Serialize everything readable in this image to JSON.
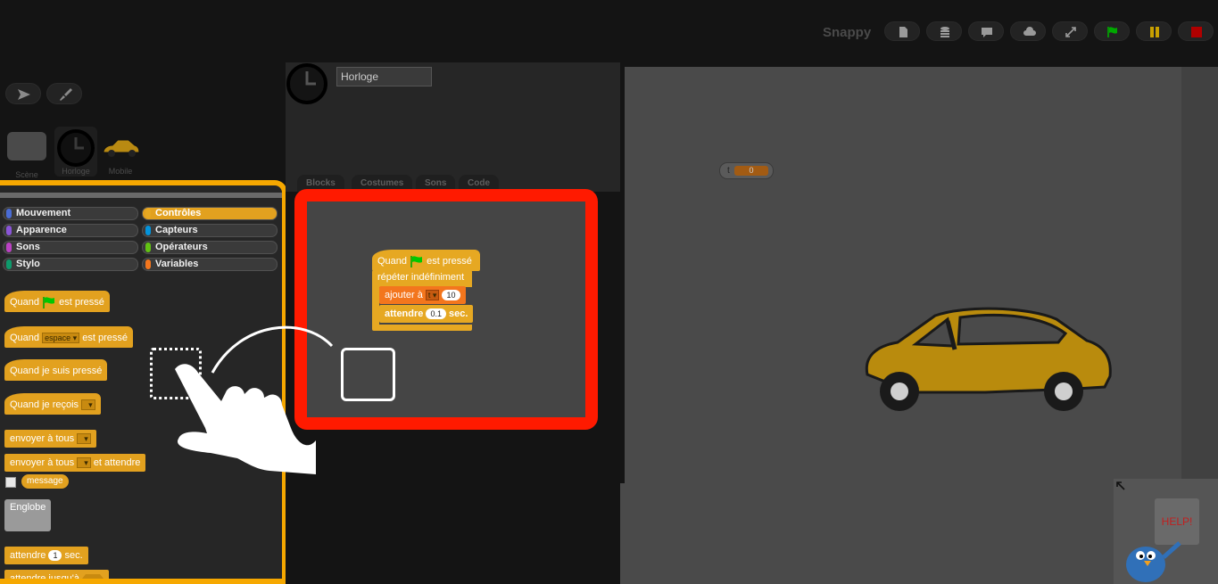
{
  "app": {
    "title": "Snappy"
  },
  "toolbar": {
    "icons": [
      "file-icon",
      "database-icon",
      "comment-icon",
      "cloud-icon",
      "fullscreen-icon",
      "green-flag-icon",
      "pause-icon",
      "stop-icon"
    ]
  },
  "corral": {
    "items": [
      {
        "label": "Scène"
      },
      {
        "label": "Horloge"
      },
      {
        "label": "Mobile"
      }
    ]
  },
  "categories": {
    "left": [
      {
        "label": "Mouvement",
        "color": "#4a6cd4"
      },
      {
        "label": "Apparence",
        "color": "#8a55d7"
      },
      {
        "label": "Sons",
        "color": "#bb42c3"
      },
      {
        "label": "Stylo",
        "color": "#0e9a6c"
      }
    ],
    "right": [
      {
        "label": "Contrôles",
        "color": "#e6a822",
        "selected": true
      },
      {
        "label": "Capteurs",
        "color": "#0494dc"
      },
      {
        "label": "Opérateurs",
        "color": "#62c213"
      },
      {
        "label": "Variables",
        "color": "#f3761d"
      }
    ]
  },
  "palette_blocks": {
    "flag_hat": {
      "when": "Quand",
      "pressed": "est pressé"
    },
    "key_hat": {
      "when": "Quand",
      "key": "espace",
      "pressed": "est pressé"
    },
    "clicked_hat": {
      "text": "Quand je suis pressé"
    },
    "receive_hat": {
      "text": "Quand je reçois"
    },
    "broadcast": {
      "text": "envoyer à tous"
    },
    "broadcast_wait": {
      "text": "envoyer à tous",
      "suffix": "et attendre"
    },
    "message": {
      "text": "message"
    },
    "wrap": {
      "text": "Englobe"
    },
    "wait": {
      "text": "attendre",
      "value": "1",
      "unit": "sec."
    },
    "wait_until": {
      "text": "attendre jusqu'à"
    }
  },
  "editor": {
    "sprite_name": "Horloge",
    "tabs": [
      "Blocks",
      "Costumes",
      "Sons",
      "Code"
    ]
  },
  "script": {
    "hat_when": "Quand",
    "hat_pressed": "est pressé",
    "forever": "répéter indéfiniment",
    "change_label": "ajouter à",
    "change_var": "t",
    "change_value": "10",
    "wait_label": "attendre",
    "wait_value": "0.1",
    "wait_unit": "sec."
  },
  "stage": {
    "watcher_name": "t",
    "watcher_value": "0"
  },
  "help": {
    "sign": "HELP!"
  }
}
